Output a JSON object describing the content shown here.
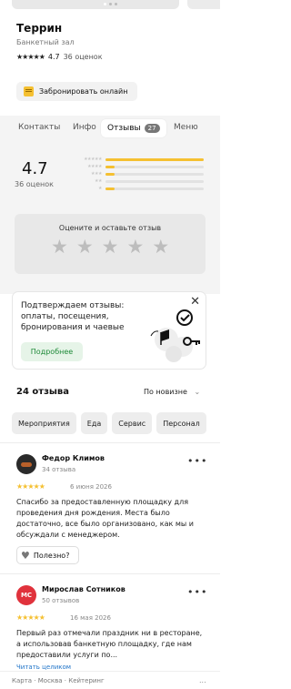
{
  "venue": {
    "name": "Террин",
    "type": "Банкетный зал",
    "rating": "4.7",
    "rating_count": "36 оценок",
    "book_label": "Забронировать онлайн"
  },
  "tabs": [
    {
      "label": "Контакты"
    },
    {
      "label": "Инфо"
    },
    {
      "label": "Отзывы",
      "badge": "27"
    },
    {
      "label": "Меню"
    }
  ],
  "summary": {
    "rating": "4.7",
    "count": "36 оценок",
    "distribution": [
      {
        "stars": 5,
        "fraction": 1.0
      },
      {
        "stars": 4,
        "fraction": 0.09
      },
      {
        "stars": 3,
        "fraction": 0.09
      },
      {
        "stars": 2,
        "fraction": 0.0
      },
      {
        "stars": 1,
        "fraction": 0.09
      }
    ],
    "rate_prompt": "Оцените и оставьте отзыв"
  },
  "verify": {
    "text": "Подтверждаем отзывы: оплаты, посещения, бронирования и чаевые",
    "button": "Подробнее",
    "close": "✕"
  },
  "reviews_header": {
    "count_label": "24 отзыва",
    "sort_label": "По новизне"
  },
  "chips": [
    "Мероприятия",
    "Еда",
    "Сервис",
    "Персонал"
  ],
  "reviews": [
    {
      "name": "Федор Климов",
      "sub": "34 отзыва",
      "date": "6 июня 2026",
      "stars": 5,
      "text": "Спасибо за предоставленную площадку для проведения дня рождения. Места было достаточно, все было организовано, как мы и обсуждали с менеджером.",
      "useful": "Полезно?",
      "avatar_color": "#2a2a2a"
    },
    {
      "name": "Мирослав Сотников",
      "sub": "50 отзывов",
      "date": "16 мая 2026",
      "stars": 5,
      "initials": "МС",
      "text": "Первый раз отмечали праздник ни в ресторане, а использовав банкетную площадку, где нам предоставили услуги по...",
      "read_more": "Читать целиком",
      "avatar_color": "#e0323c"
    }
  ],
  "breadcrumb": "Карта · Москва · Кейтеринг",
  "breadcrumb_more": "..."
}
